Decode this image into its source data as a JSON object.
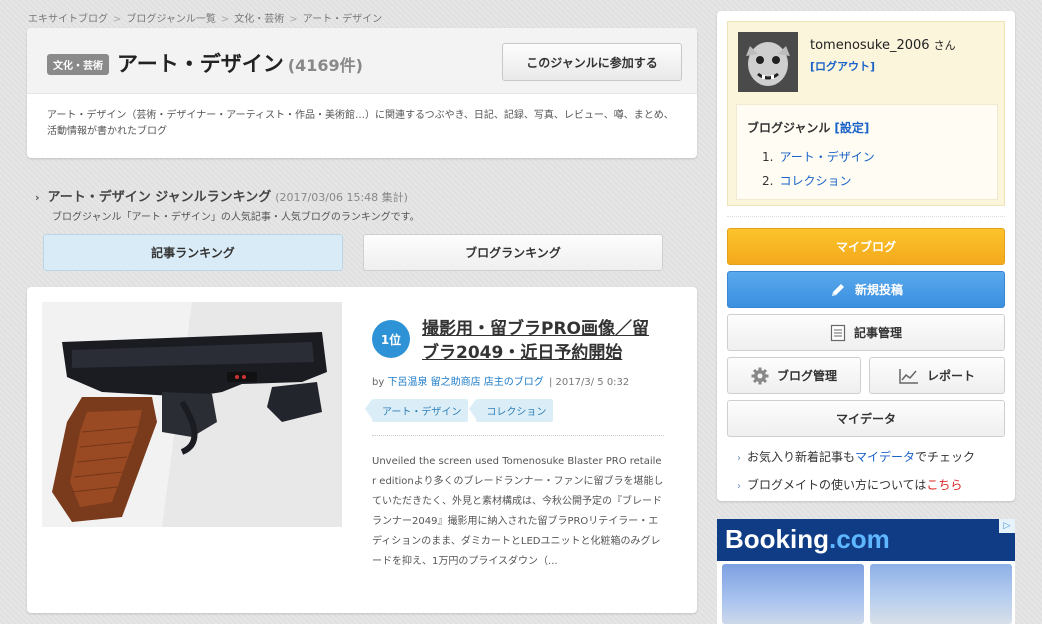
{
  "breadcrumb": [
    "エキサイトブログ",
    "ブログジャンル一覧",
    "文化・芸術",
    "アート・デザイン"
  ],
  "genre": {
    "badge": "文化・芸術",
    "title": "アート・デザイン",
    "count": "(4169件)",
    "join_label": "このジャンルに参加する",
    "description": "アート・デザイン（芸術・デザイナー・アーティスト・作品・美術館…）に関連するつぶやき、日記、記録、写真、レビュー、噂、まとめ、活動情報が書かれたブログ"
  },
  "ranking": {
    "title": "アート・デザイン ジャンルランキング",
    "date": "(2017/03/06 15:48 集計)",
    "subtitle": "ブログジャンル「アート・デザイン」の人気記事・人気ブログのランキングです。",
    "tab_articles": "記事ランキング",
    "tab_blogs": "ブログランキング"
  },
  "article": {
    "rank": "1位",
    "title": "撮影用・留ブラPRO画像／留ブラ2049・近日予約開始",
    "by": "by",
    "author": "下呂温泉 留之助商店 店主のブログ",
    "date": "| 2017/3/ 5 0:32",
    "tags": [
      "アート・デザイン",
      "コレクション"
    ],
    "excerpt": "Unveiled the screen used Tomenosuke Blaster PRO retailer editionより多くのブレードランナー・ファンに留ブラを堪能していただきたく、外見と素材構成は、今秋公開予定の『ブレードランナー2049』撮影用に納入された留ブラPROリテイラー・エディションのまま、ダミカートとLEDユニットと化粧箱のみグレードを抑え、1万円のプライスダウン（..."
  },
  "sidebar": {
    "username": "tomenosuke_2006",
    "san": "さん",
    "logout": "[ログアウト]",
    "genre_title": "ブログジャンル",
    "genre_settings": "[設定]",
    "genres": [
      {
        "num": "1.",
        "label": "アート・デザイン"
      },
      {
        "num": "2.",
        "label": "コレクション"
      }
    ],
    "my_blog": "マイブログ",
    "new_post": "新規投稿",
    "article_manage": "記事管理",
    "blog_manage": "ブログ管理",
    "report": "レポート",
    "my_data": "マイデータ",
    "link1_pre": "お気入り新着記事も",
    "link1_link": "マイデータ",
    "link1_post": "でチェック",
    "link2_pre": "ブログメイトの使い方については",
    "link2_link": "こちら"
  },
  "ad": {
    "logo_main": "Booking",
    "logo_dot": ".",
    "logo_com": "com",
    "adchoice": "▷"
  },
  "icons": [
    "chevron-right-icon",
    "pencil-icon",
    "document-icon",
    "gear-icon",
    "chart-icon"
  ],
  "colors": {
    "accent_blue": "#2e92d6",
    "link_blue": "#1a62c8",
    "myblog_yellow": "#f4a91c",
    "newpost_blue": "#3a8fe0",
    "booking_navy": "#0f3c85"
  }
}
